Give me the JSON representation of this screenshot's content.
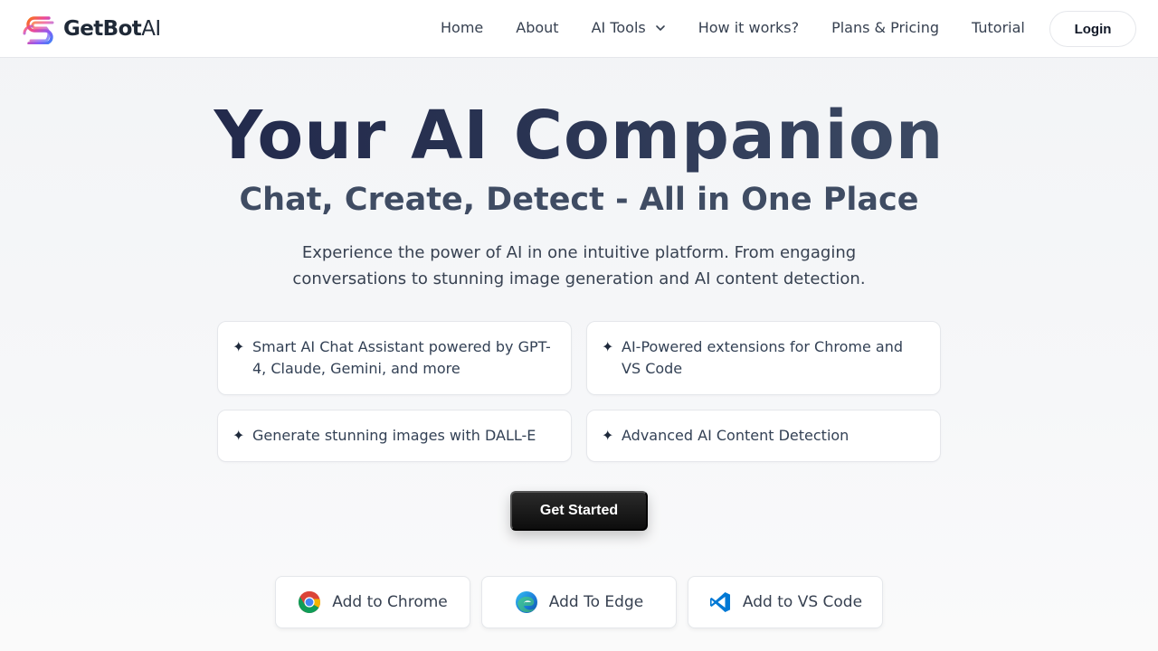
{
  "brand": {
    "name_main": "GetBot",
    "name_suffix": "AI"
  },
  "nav": {
    "links": [
      "Home",
      "About",
      "AI Tools",
      "How it works?",
      "Plans & Pricing",
      "Tutorial"
    ],
    "login_label": "Login"
  },
  "hero": {
    "title": "Your AI Companion",
    "subtitle": "Chat, Create, Detect - All in One Place",
    "description": "Experience the power of AI in one intuitive platform. From engaging conversations to stunning image generation and AI content detection."
  },
  "features": [
    {
      "icon": "sparkle-icon",
      "text": "Smart AI Chat Assistant powered by GPT-4, Claude, Gemini, and more"
    },
    {
      "icon": "sparkle-icon",
      "text": "AI-Powered extensions for Chrome and VS Code"
    },
    {
      "icon": "sparkle-icon",
      "text": "Generate stunning images with DALL-E"
    },
    {
      "icon": "sparkle-icon",
      "text": "Advanced AI Content Detection"
    }
  ],
  "cta": {
    "label": "Get Started"
  },
  "extensions": [
    {
      "icon": "chrome-icon",
      "label": "Add to Chrome"
    },
    {
      "icon": "edge-icon",
      "label": "Add To Edge"
    },
    {
      "icon": "vscode-icon",
      "label": "Add to VS Code"
    }
  ],
  "colors": {
    "title_gradient_start": "#1e2448",
    "title_gradient_end": "#46566c",
    "cta_background": "#111111",
    "logo_gradient": [
      "#f43f5e",
      "#a855f7",
      "#3b82f6"
    ]
  }
}
